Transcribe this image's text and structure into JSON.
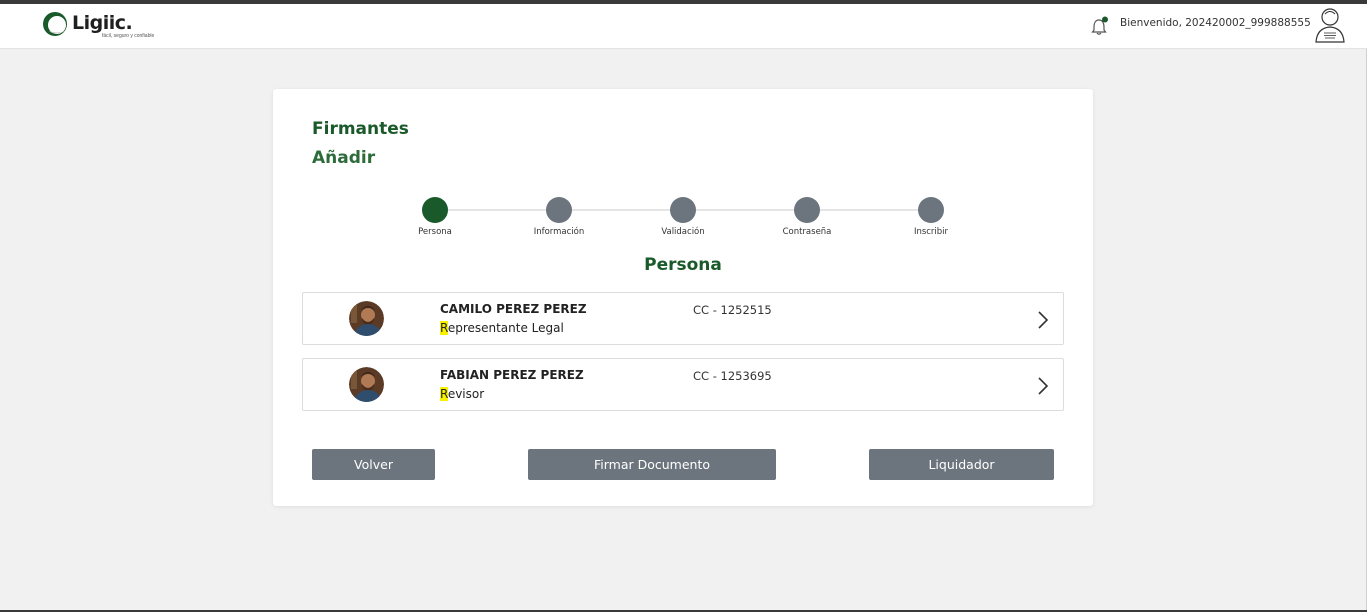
{
  "header": {
    "logo_text": "Ligiic.",
    "logo_tagline": "fácil, seguro y confiable",
    "welcome_text": "Bienvenido, 202420002_999888555",
    "notification_dot_color": "#1a5a2a"
  },
  "page": {
    "title": "Firmantes",
    "subtitle": "Añadir"
  },
  "stepper": {
    "steps": [
      {
        "label": "Persona",
        "active": true
      },
      {
        "label": "Información",
        "active": false
      },
      {
        "label": "Validación",
        "active": false
      },
      {
        "label": "Contraseña",
        "active": false
      },
      {
        "label": "Inscribir",
        "active": false
      }
    ]
  },
  "section": {
    "title": "Persona"
  },
  "signers": [
    {
      "name": "CAMILO PEREZ PEREZ",
      "role_first": "R",
      "role_rest": "epresentante Legal",
      "document": "CC - 1252515"
    },
    {
      "name": "FABIAN PEREZ PEREZ",
      "role_first": "R",
      "role_rest": "evisor",
      "document": "CC - 1253695"
    }
  ],
  "actions": {
    "back_label": "Volver",
    "sign_label": "Firmar Documento",
    "liquidator_label": "Liquidador"
  },
  "colors": {
    "brand_green": "#1a5a2a",
    "step_inactive": "#6c757d",
    "button_bg": "#6c757d",
    "highlight": "#f7f300"
  }
}
